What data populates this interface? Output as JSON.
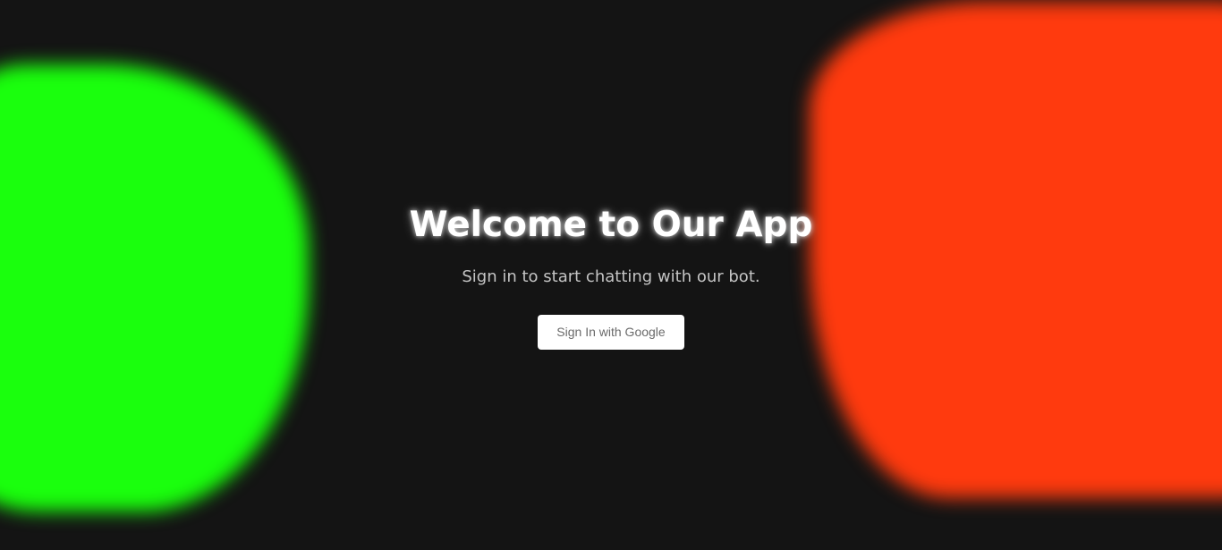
{
  "hero": {
    "title": "Welcome to Our App",
    "subtitle": "Sign in to start chatting with our bot.",
    "signin_label": "Sign In with Google"
  },
  "colors": {
    "background": "#141414",
    "blob_green": "#1aff0d",
    "blob_orange": "#ff3a0e",
    "title": "#ffffff",
    "subtitle": "#c4c4c4",
    "button_bg": "#ffffff",
    "button_text": "#6b6b6b"
  }
}
